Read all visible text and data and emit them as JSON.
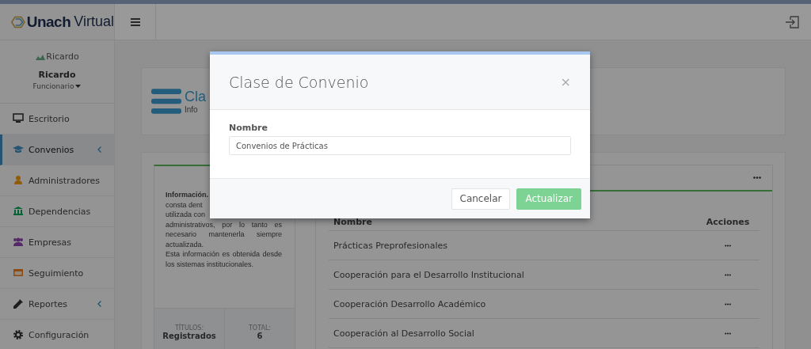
{
  "brand": {
    "strong": "Unach",
    "light": "Virtual"
  },
  "user": {
    "avatar_alt": "Ricardo",
    "name": "Ricardo",
    "role": "Funcionario"
  },
  "sidebar": {
    "items": [
      {
        "label": "Escritorio",
        "selected": false,
        "expandable": false
      },
      {
        "label": "Convenios",
        "selected": true,
        "expandable": true
      },
      {
        "label": "Administradores",
        "selected": false,
        "expandable": false
      },
      {
        "label": "Dependencias",
        "selected": false,
        "expandable": false
      },
      {
        "label": "Empresas",
        "selected": false,
        "expandable": false
      },
      {
        "label": "Seguimiento",
        "selected": false,
        "expandable": false
      },
      {
        "label": "Reportes",
        "selected": false,
        "expandable": true
      },
      {
        "label": "Configuración",
        "selected": false,
        "expandable": false
      }
    ]
  },
  "page_header": {
    "title": "Cla",
    "subtitle": "Info"
  },
  "info_panel": {
    "lines": [
      "**Información.**",
      "consta dent",
      "utilizada con"
    ],
    "paragraph": "administrativos, por lo tanto es necesario mantenerla siempre actualizada.",
    "paragraph_2": "Esta información es obtenida desde los sistemas institucionales.",
    "stats": [
      {
        "label": "TÍTULOS:",
        "value": "Registrados"
      },
      {
        "label": "TOTAL:",
        "value": "6"
      }
    ]
  },
  "table": {
    "columns": [
      "Nombre",
      "Acciones"
    ],
    "rows": [
      {
        "name": "Prácticas Preprofesionales"
      },
      {
        "name": "Cooperación para el Desarrollo Institucional"
      },
      {
        "name": "Cooperación Desarrollo Académico"
      },
      {
        "name": "Cooperación al Desarrollo Social"
      }
    ]
  },
  "modal": {
    "title": "Clase de Convenio",
    "close": "×",
    "field_label": "Nombre",
    "field_value": "Convenios de Prácticas",
    "buttons": [
      {
        "label": "Cancelar",
        "kind": "default"
      },
      {
        "label": "Actualizar",
        "kind": "primary"
      }
    ]
  }
}
